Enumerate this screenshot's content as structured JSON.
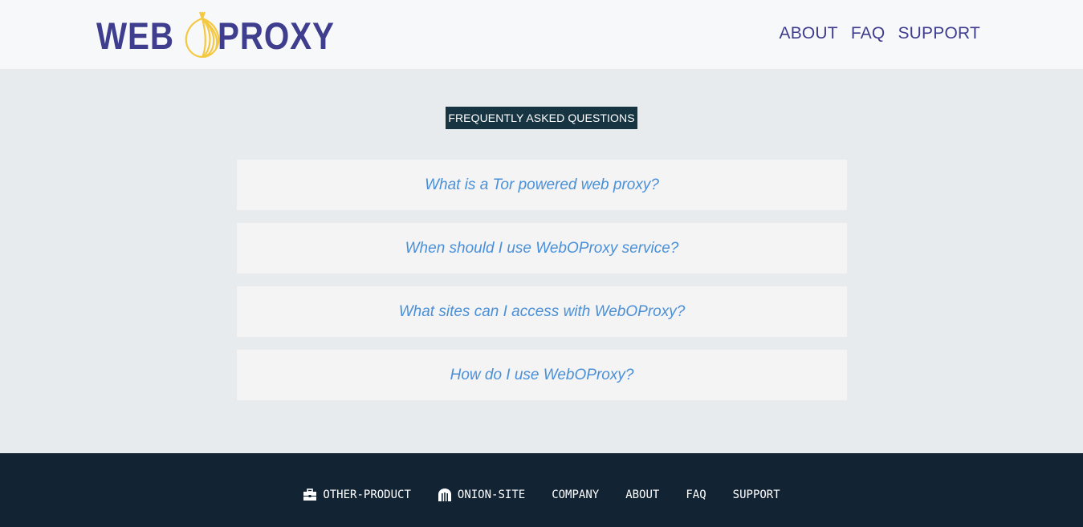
{
  "header": {
    "logo": {
      "left_text": "WEB",
      "right_text": "PROXY",
      "icon": "onion-icon"
    },
    "nav": [
      {
        "label": "ABOUT"
      },
      {
        "label": "FAQ"
      },
      {
        "label": "SUPPORT"
      }
    ]
  },
  "main": {
    "section_title": "FREQUENTLY ASKED QUESTIONS",
    "questions": [
      {
        "text": "What is a Tor powered web proxy?"
      },
      {
        "text": "When should I use WebOProxy service?"
      },
      {
        "text": "What sites can I access with WebOProxy?"
      },
      {
        "text": "How do I use WebOProxy?"
      }
    ]
  },
  "footer": {
    "links": [
      {
        "label": "OTHER-PRODUCT",
        "icon": "toolbox-icon"
      },
      {
        "label": "ONION-SITE",
        "icon": "dungeon-icon"
      },
      {
        "label": "COMPANY"
      },
      {
        "label": "ABOUT"
      },
      {
        "label": "FAQ"
      },
      {
        "label": "SUPPORT"
      }
    ]
  },
  "colors": {
    "brand": "#3f3d8e",
    "onion": "#f5c842",
    "link": "#4a90d9",
    "badge": "#163442",
    "footer_bg": "#122334",
    "page_bg": "#e8ebee"
  }
}
